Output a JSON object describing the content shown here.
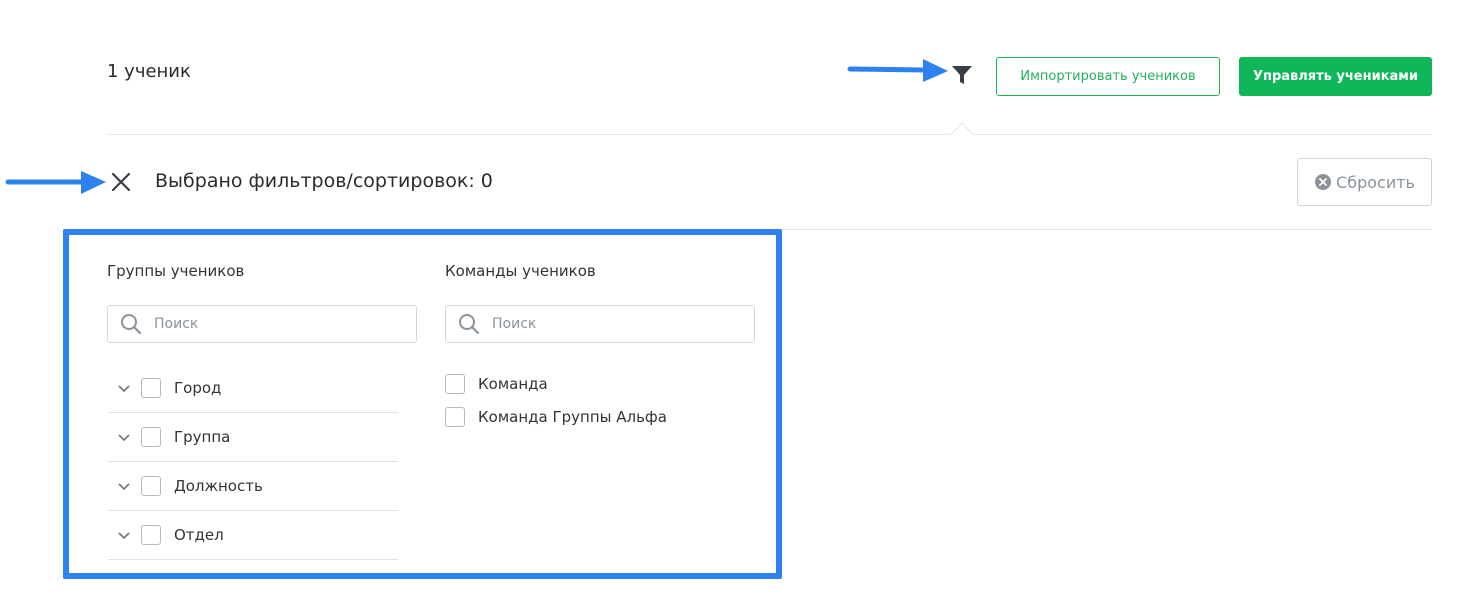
{
  "header": {
    "student_count": "1 ученик",
    "filter_icon": "filter-funnel-icon",
    "import_button": "Импортировать учеников",
    "manage_button": "Управлять учениками"
  },
  "filter_bar": {
    "selected_label": "Выбрано фильтров/сортировок: 0",
    "reset_button": "Сбросить",
    "close_icon": "close-x-icon",
    "reset_icon": "circle-x-icon"
  },
  "groups": {
    "title": "Группы учеников",
    "search_placeholder": "Поиск",
    "items": [
      {
        "label": "Город",
        "checked": false
      },
      {
        "label": "Группа",
        "checked": false
      },
      {
        "label": "Должность",
        "checked": false
      },
      {
        "label": "Отдел",
        "checked": false
      }
    ]
  },
  "teams": {
    "title": "Команды учеников",
    "search_placeholder": "Поиск",
    "items": [
      {
        "label": "Команда",
        "checked": false
      },
      {
        "label": "Команда Группы Альфа",
        "checked": false
      }
    ]
  },
  "colors": {
    "accent_green": "#0fb65a",
    "annotation_blue": "#2d82f0"
  }
}
